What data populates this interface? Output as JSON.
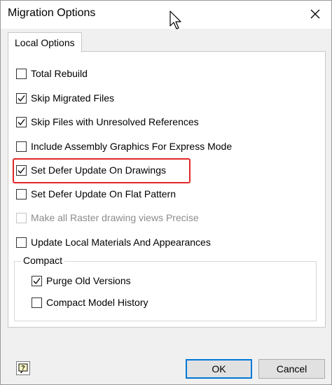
{
  "window": {
    "title": "Migration Options"
  },
  "tabs": [
    {
      "label": "Local Options"
    }
  ],
  "options": [
    {
      "label": "Total Rebuild",
      "checked": false,
      "enabled": true
    },
    {
      "label": "Skip Migrated Files",
      "checked": true,
      "enabled": true
    },
    {
      "label": "Skip Files with Unresolved References",
      "checked": true,
      "enabled": true
    },
    {
      "label": "Include Assembly Graphics For Express Mode",
      "checked": false,
      "enabled": true
    },
    {
      "label": "Set Defer Update On Drawings",
      "checked": true,
      "enabled": true
    },
    {
      "label": "Set Defer Update On Flat Pattern",
      "checked": false,
      "enabled": true
    },
    {
      "label": "Make all Raster drawing views Precise",
      "checked": false,
      "enabled": false
    },
    {
      "label": "Update Local Materials And Appearances",
      "checked": false,
      "enabled": true
    }
  ],
  "compact": {
    "title": "Compact",
    "options": [
      {
        "label": "Purge Old Versions",
        "checked": true
      },
      {
        "label": "Compact Model History",
        "checked": false
      }
    ]
  },
  "buttons": {
    "ok": "OK",
    "cancel": "Cancel"
  },
  "icons": {
    "close": "close-icon",
    "help": "help-icon",
    "cursor": "mouse-cursor-icon"
  },
  "colors": {
    "highlight": "#e32626",
    "default_button_border": "#0078d7"
  }
}
